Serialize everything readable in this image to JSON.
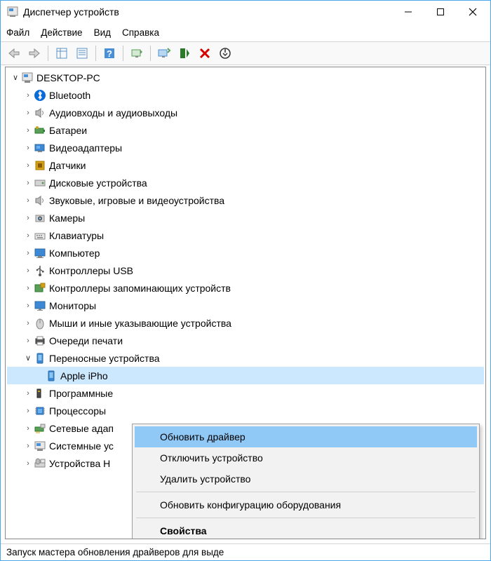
{
  "window": {
    "title": "Диспетчер устройств"
  },
  "menu": {
    "file": "Файл",
    "action": "Действие",
    "view": "Вид",
    "help": "Справка"
  },
  "tree": {
    "root": "DESKTOP-PC",
    "items": [
      "Bluetooth",
      "Аудиовходы и аудиовыходы",
      "Батареи",
      "Видеоадаптеры",
      "Датчики",
      "Дисковые устройства",
      "Звуковые, игровые и видеоустройства",
      "Камеры",
      "Клавиатуры",
      "Компьютер",
      "Контроллеры USB",
      "Контроллеры запоминающих устройств",
      "Мониторы",
      "Мыши и иные указывающие устройства",
      "Очереди печати",
      "Переносные устройства",
      "Программные",
      "Процессоры",
      "Сетевые адап",
      "Системные ус",
      "Устройства H"
    ],
    "child_device": "Apple iPho"
  },
  "context": {
    "update": "Обновить драйвер",
    "disable": "Отключить устройство",
    "uninstall": "Удалить устройство",
    "scan": "Обновить конфигурацию оборудования",
    "properties": "Свойства"
  },
  "status": "Запуск мастера обновления драйверов для выде"
}
